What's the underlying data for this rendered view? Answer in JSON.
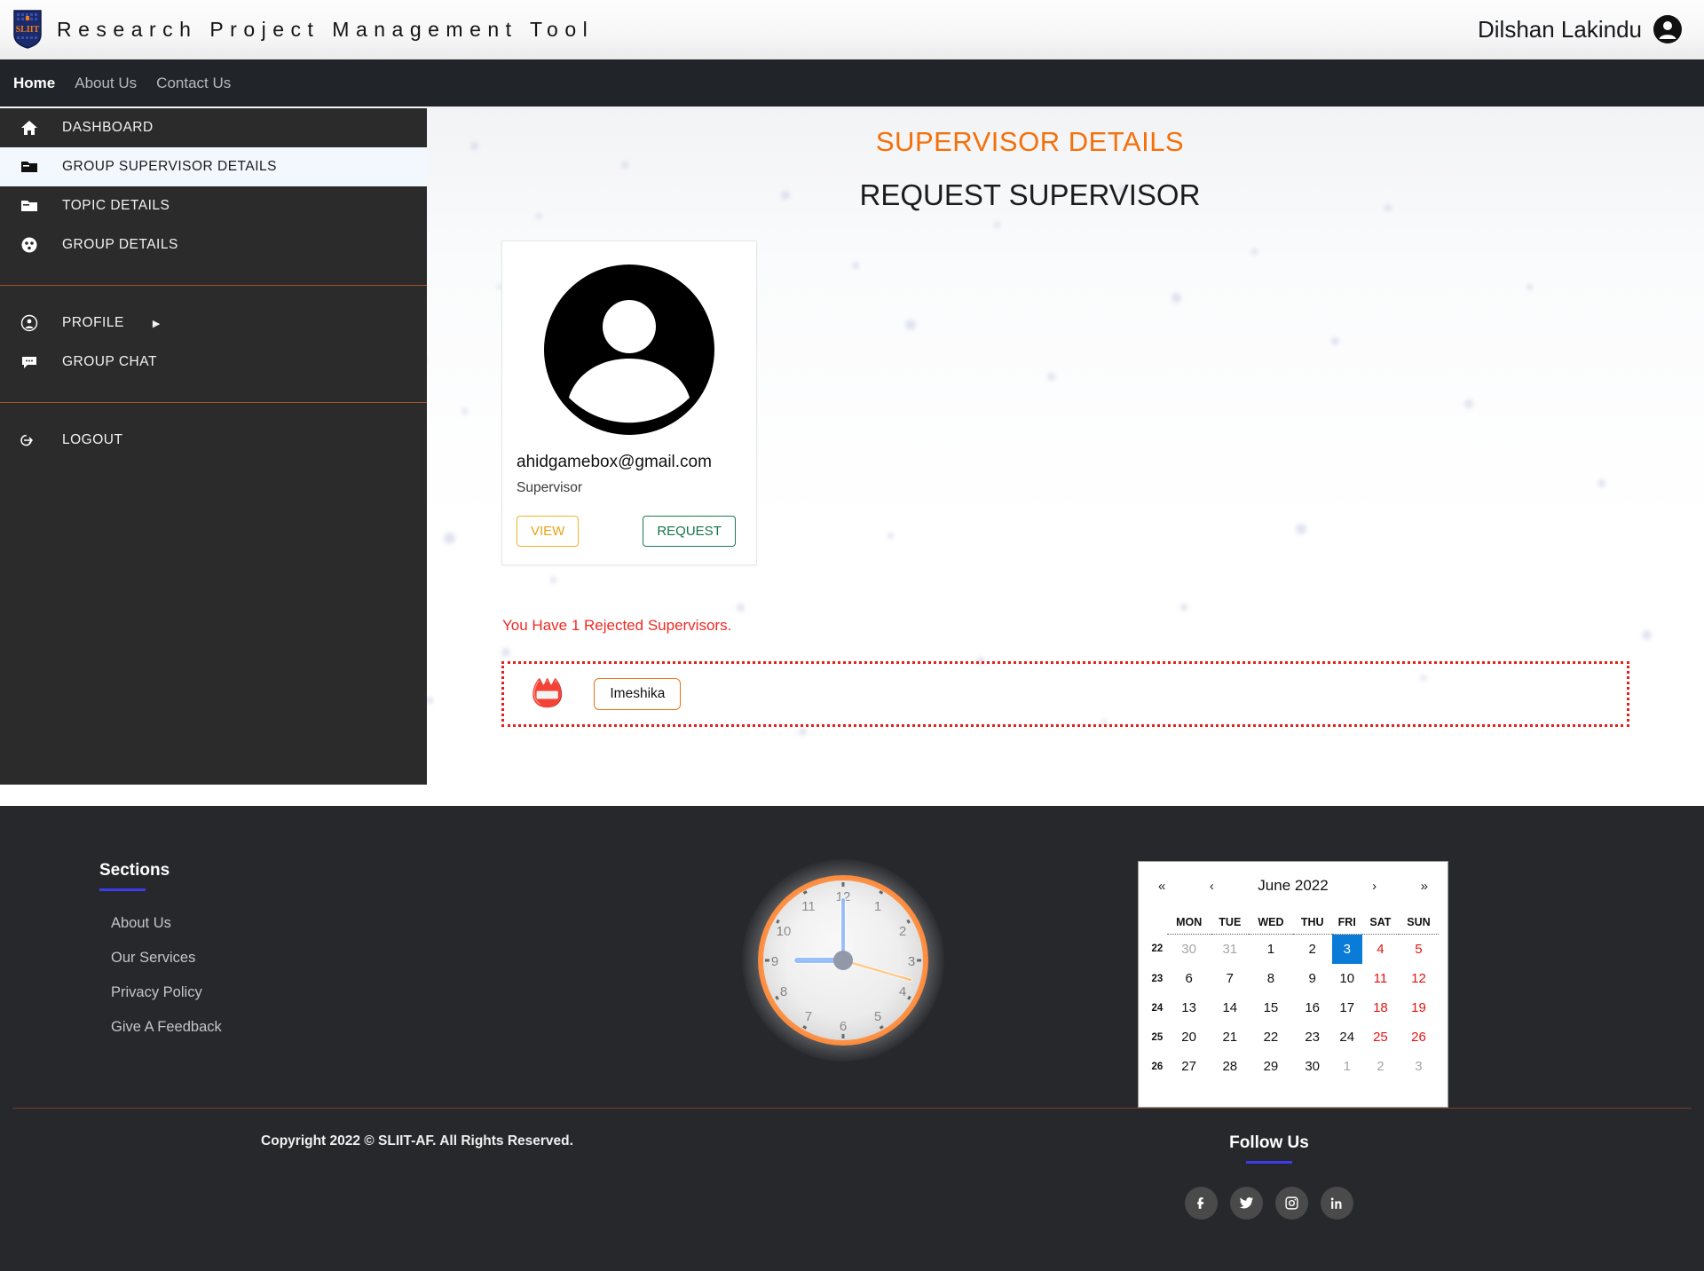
{
  "header": {
    "logo_alt": "SLIIT logo",
    "title": "Research Project Management Tool",
    "user_name": "Dilshan Lakindu"
  },
  "navbar": {
    "items": [
      {
        "label": "Home",
        "active": true
      },
      {
        "label": "About Us",
        "active": false
      },
      {
        "label": "Contact Us",
        "active": false
      }
    ]
  },
  "sidebar": {
    "items": [
      {
        "label": "DASHBOARD",
        "icon": "home-icon",
        "active": false
      },
      {
        "label": "GROUP SUPERVISOR DETAILS",
        "icon": "folder-icon",
        "active": true
      },
      {
        "label": "TOPIC DETAILS",
        "icon": "folder-icon",
        "active": false
      },
      {
        "label": "GROUP DETAILS",
        "icon": "group-icon",
        "active": false
      },
      {
        "label": "PROFILE",
        "icon": "user-circle-icon",
        "active": false,
        "caret": "▶"
      },
      {
        "label": "GROUP CHAT",
        "icon": "chat-icon",
        "active": false
      },
      {
        "label": "LOGOUT",
        "icon": "logout-icon",
        "active": false
      }
    ]
  },
  "main": {
    "title_primary": "SUPERVISOR DETAILS",
    "title_secondary": "REQUEST SUPERVISOR",
    "supervisor_card": {
      "email": "ahidgamebox@gmail.com",
      "role": "Supervisor",
      "view_label": "VIEW",
      "request_label": "REQUEST"
    },
    "rejected_message": "You Have 1 Rejected Supervisors.",
    "rejected_items": [
      {
        "name": "Imeshika",
        "icon": "stamp-icon",
        "glyph": "📛"
      }
    ]
  },
  "footer": {
    "sections_heading": "Sections",
    "links": [
      "About Us",
      "Our Services",
      "Privacy Policy",
      "Give A Feedback"
    ],
    "clock": {
      "numerals": [
        "12",
        "1",
        "2",
        "3",
        "4",
        "5",
        "6",
        "7",
        "8",
        "9",
        "10",
        "11"
      ],
      "hour": 9,
      "minute": 0,
      "second": 16
    },
    "calendar": {
      "month_label": "June 2022",
      "nav": {
        "first": "«",
        "prev": "‹",
        "next": "›",
        "last": "»"
      },
      "weekday_headers": [
        "MON",
        "TUE",
        "WED",
        "THU",
        "FRI",
        "SAT",
        "SUN"
      ],
      "week_numbers": [
        "22",
        "23",
        "24",
        "25",
        "26"
      ],
      "weeks": [
        [
          {
            "d": "30",
            "state": "muted"
          },
          {
            "d": "31",
            "state": "muted"
          },
          {
            "d": "1",
            "state": "normal"
          },
          {
            "d": "2",
            "state": "normal"
          },
          {
            "d": "3",
            "state": "today"
          },
          {
            "d": "4",
            "state": "weekend"
          },
          {
            "d": "5",
            "state": "weekend"
          }
        ],
        [
          {
            "d": "6",
            "state": "normal"
          },
          {
            "d": "7",
            "state": "normal"
          },
          {
            "d": "8",
            "state": "normal"
          },
          {
            "d": "9",
            "state": "normal"
          },
          {
            "d": "10",
            "state": "normal"
          },
          {
            "d": "11",
            "state": "weekend"
          },
          {
            "d": "12",
            "state": "weekend"
          }
        ],
        [
          {
            "d": "13",
            "state": "normal"
          },
          {
            "d": "14",
            "state": "normal"
          },
          {
            "d": "15",
            "state": "normal"
          },
          {
            "d": "16",
            "state": "normal"
          },
          {
            "d": "17",
            "state": "normal"
          },
          {
            "d": "18",
            "state": "weekend"
          },
          {
            "d": "19",
            "state": "weekend"
          }
        ],
        [
          {
            "d": "20",
            "state": "normal"
          },
          {
            "d": "21",
            "state": "normal"
          },
          {
            "d": "22",
            "state": "normal"
          },
          {
            "d": "23",
            "state": "normal"
          },
          {
            "d": "24",
            "state": "normal"
          },
          {
            "d": "25",
            "state": "weekend"
          },
          {
            "d": "26",
            "state": "weekend"
          }
        ],
        [
          {
            "d": "27",
            "state": "normal"
          },
          {
            "d": "28",
            "state": "normal"
          },
          {
            "d": "29",
            "state": "normal"
          },
          {
            "d": "30",
            "state": "normal"
          },
          {
            "d": "1",
            "state": "muted"
          },
          {
            "d": "2",
            "state": "muted"
          },
          {
            "d": "3",
            "state": "muted"
          }
        ]
      ]
    },
    "copyright": "Copyright 2022 © SLIIT-AF. All Rights Reserved.",
    "follow_heading": "Follow Us",
    "social": [
      {
        "name": "facebook-icon"
      },
      {
        "name": "twitter-icon"
      },
      {
        "name": "instagram-icon"
      },
      {
        "name": "linkedin-icon"
      }
    ]
  },
  "colors": {
    "accent_orange": "#f4700a",
    "danger_red": "#ef2b24",
    "today_blue": "#0a7cd8",
    "underline_blue": "#3b3bf0",
    "sidebar_bg": "#2b2b2b"
  }
}
